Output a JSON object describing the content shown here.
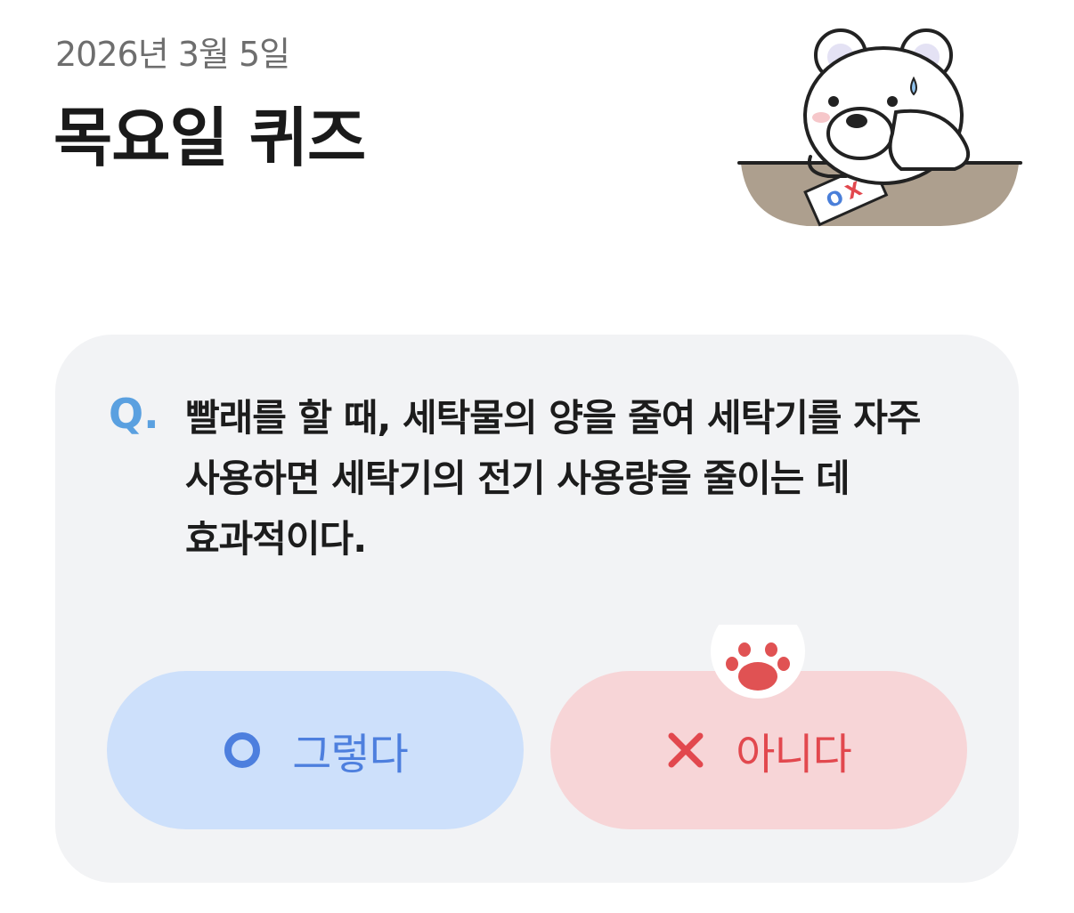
{
  "header": {
    "date": "2026년 3월 5일",
    "title": "목요일 퀴즈"
  },
  "mascot": {
    "icon": "polar-bear-ox-quiz-icon",
    "paper_o": "O",
    "paper_x": "X"
  },
  "quiz": {
    "q_prefix": "Q.",
    "question_line1": "빨래를 할 때, 세탁물의 양을 줄여 세탁기를 자주",
    "question_line2": "사용하면 세탁기의 전기 사용량을 줄이는 데",
    "question_line3": "효과적이다.",
    "answers": [
      {
        "label": "그렇다",
        "icon": "circle-o-icon",
        "color": "#4d7fde",
        "bg": "#cde0fb"
      },
      {
        "label": "아니다",
        "icon": "x-mark-icon",
        "color": "#e2484e",
        "bg": "#f7d5d7"
      }
    ],
    "selection_badge_icon": "paw-icon"
  },
  "colors": {
    "card_bg": "#f2f3f5",
    "q_accent": "#5aa0e0"
  }
}
